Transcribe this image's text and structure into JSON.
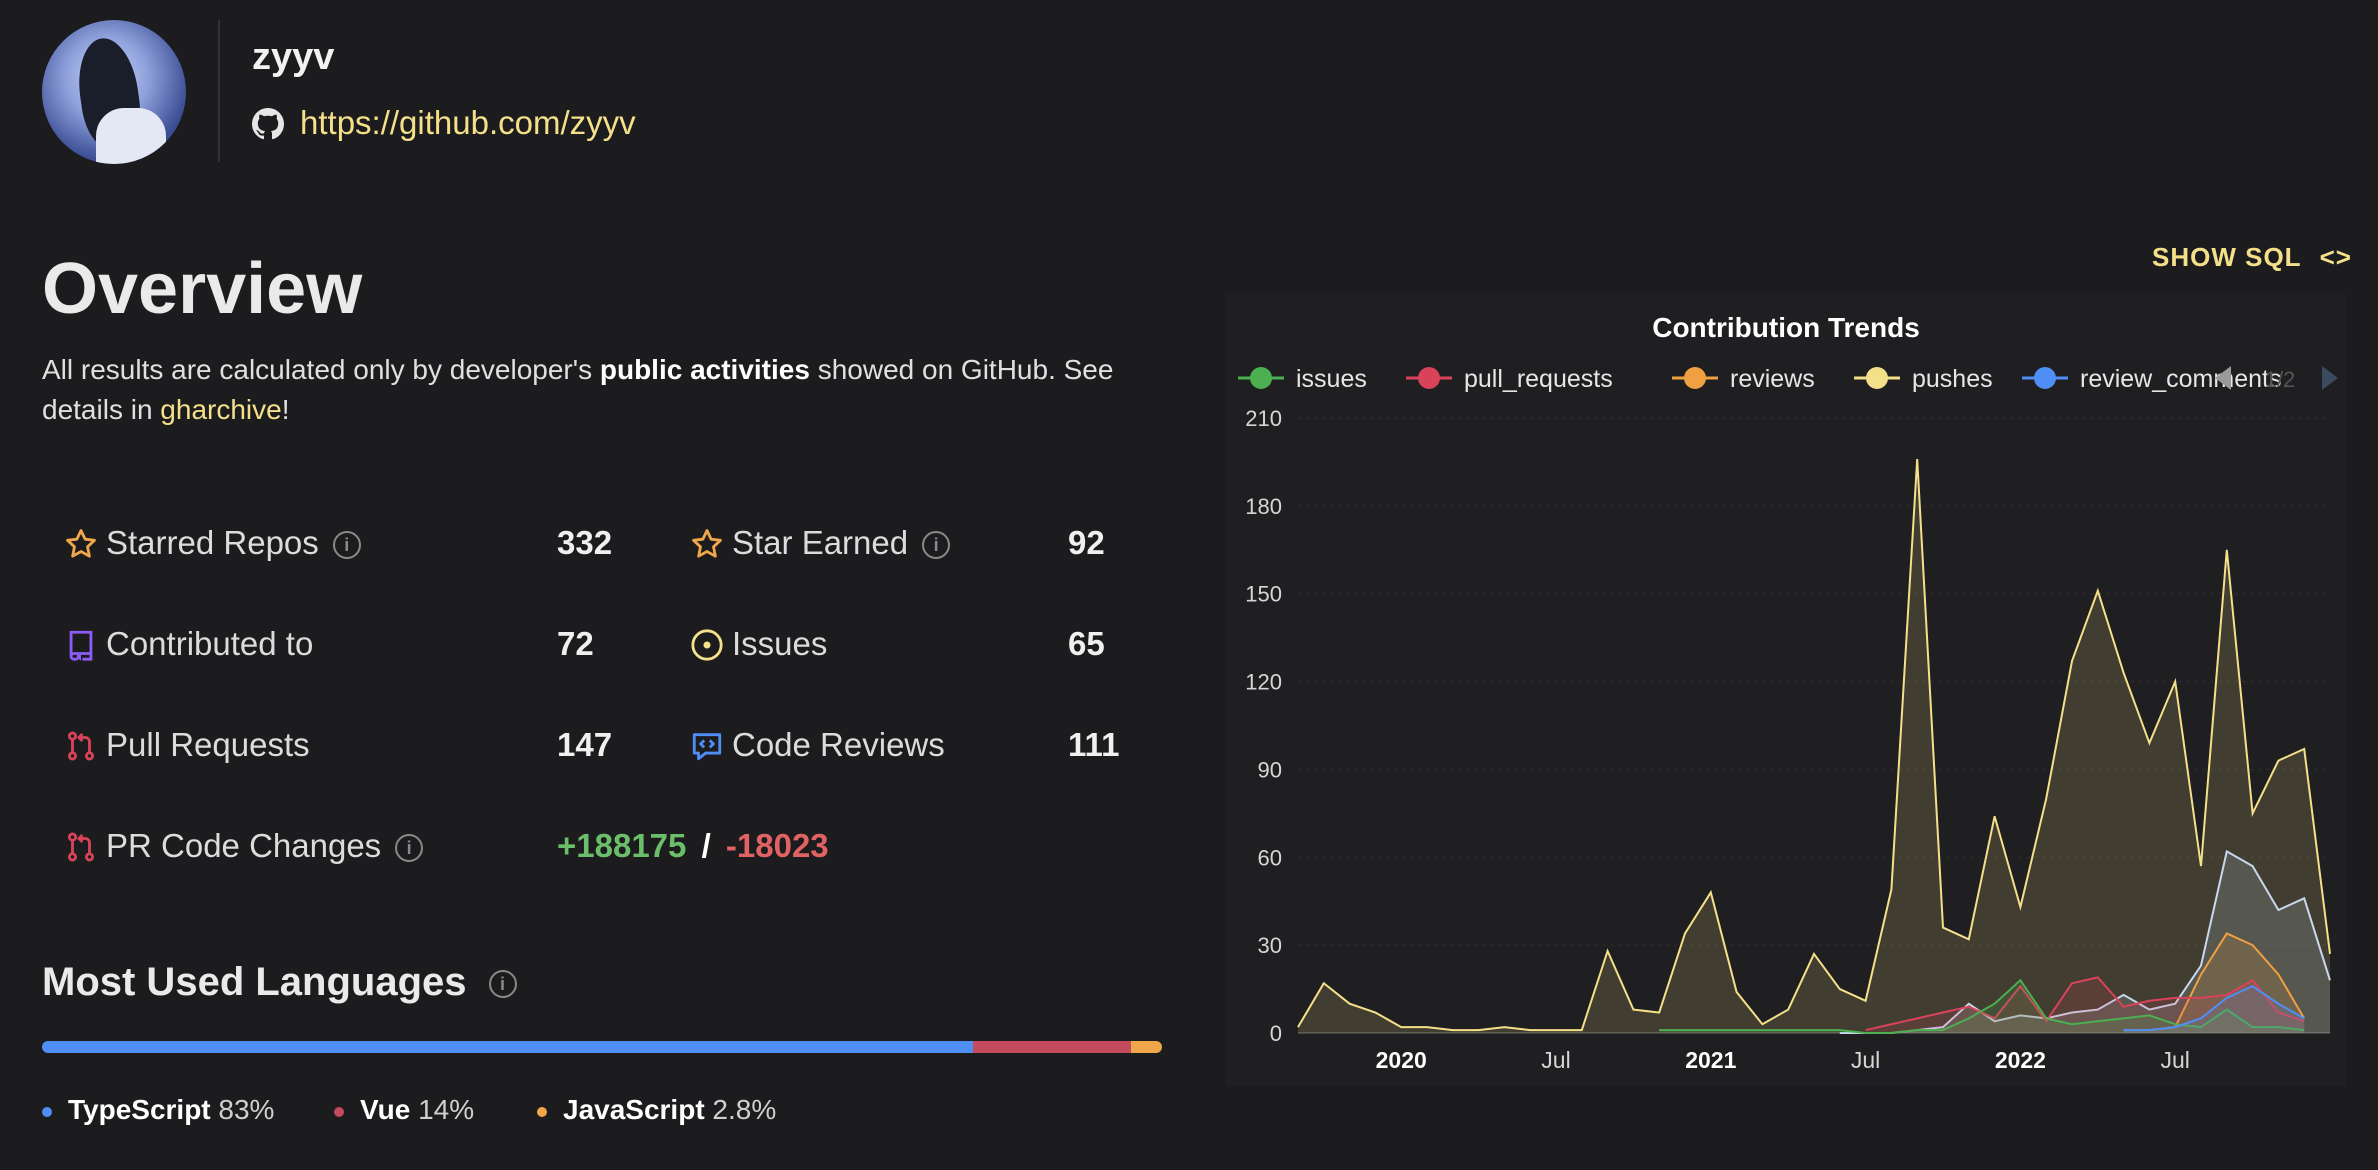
{
  "profile": {
    "username": "zyyv",
    "github_url": "https://github.com/zyyv"
  },
  "overview": {
    "title": "Overview",
    "desc_before": "All results are calculated only by developer's ",
    "desc_bold": "public activities",
    "desc_mid": " showed on GitHub. See details in ",
    "desc_link": "gharchive",
    "desc_after": "!",
    "stats": {
      "starred_repos": {
        "label": "Starred Repos",
        "value": "332"
      },
      "star_earned": {
        "label": "Star Earned",
        "value": "92"
      },
      "contributed_to": {
        "label": "Contributed to",
        "value": "72"
      },
      "issues": {
        "label": "Issues",
        "value": "65"
      },
      "pull_requests": {
        "label": "Pull Requests",
        "value": "147"
      },
      "code_reviews": {
        "label": "Code Reviews",
        "value": "111"
      },
      "pr_code_changes": {
        "label": "PR Code Changes",
        "additions": "+188175",
        "separator": "/",
        "deletions": "-18023"
      }
    }
  },
  "languages": {
    "title": "Most Used Languages",
    "items": [
      {
        "name": "TypeScript",
        "percent": "83%",
        "share": 83,
        "color": "#4f8ef5"
      },
      {
        "name": "Vue",
        "percent": "14%",
        "share": 14,
        "color": "#c44a5e"
      },
      {
        "name": "JavaScript",
        "percent": "2.8%",
        "share": 2.8,
        "color": "#f0a64a"
      }
    ]
  },
  "chart_toolbar": {
    "show_sql_label": "SHOW SQL",
    "code_icon": "code-brackets-icon",
    "legend_page": "1/2"
  },
  "chart_data": {
    "type": "area",
    "title": "Contribution Trends",
    "ylim": [
      0,
      210
    ],
    "y_ticks": [
      "0",
      "30",
      "60",
      "90",
      "120",
      "150",
      "180",
      "210"
    ],
    "x_range": [
      "2019-09",
      "2022-12"
    ],
    "x_ticks": [
      {
        "label": "2020",
        "date": "2020-01",
        "bold": true
      },
      {
        "label": "Jul",
        "date": "2020-07",
        "bold": false
      },
      {
        "label": "2021",
        "date": "2021-01",
        "bold": true
      },
      {
        "label": "Jul",
        "date": "2021-07",
        "bold": false
      },
      {
        "label": "2022",
        "date": "2022-01",
        "bold": true
      },
      {
        "label": "Jul",
        "date": "2022-07",
        "bold": false
      }
    ],
    "grid": true,
    "legend_position": "top",
    "series": [
      {
        "name": "issues",
        "color": "#4caf50",
        "points": [
          [
            "2020-11",
            1
          ],
          [
            "2020-12",
            1
          ],
          [
            "2021-01",
            1
          ],
          [
            "2021-02",
            1
          ],
          [
            "2021-03",
            1
          ],
          [
            "2021-04",
            1
          ],
          [
            "2021-05",
            1
          ],
          [
            "2021-06",
            1
          ],
          [
            "2021-07",
            0
          ],
          [
            "2021-08",
            0
          ],
          [
            "2021-09",
            1
          ],
          [
            "2021-10",
            1
          ],
          [
            "2021-11",
            5
          ],
          [
            "2021-12",
            10
          ],
          [
            "2022-01",
            18
          ],
          [
            "2022-02",
            5
          ],
          [
            "2022-03",
            3
          ],
          [
            "2022-04",
            4
          ],
          [
            "2022-05",
            5
          ],
          [
            "2022-06",
            6
          ],
          [
            "2022-07",
            3
          ],
          [
            "2022-08",
            2
          ],
          [
            "2022-09",
            8
          ],
          [
            "2022-10",
            2
          ],
          [
            "2022-11",
            2
          ],
          [
            "2022-12",
            1
          ]
        ]
      },
      {
        "name": "pull_requests",
        "color": "#d9435a",
        "points": [
          [
            "2021-07",
            1
          ],
          [
            "2021-08",
            3
          ],
          [
            "2021-09",
            5
          ],
          [
            "2021-10",
            7
          ],
          [
            "2021-11",
            9
          ],
          [
            "2021-12",
            5
          ],
          [
            "2022-01",
            16
          ],
          [
            "2022-02",
            4
          ],
          [
            "2022-03",
            17
          ],
          [
            "2022-04",
            19
          ],
          [
            "2022-05",
            9
          ],
          [
            "2022-06",
            11
          ],
          [
            "2022-07",
            12
          ],
          [
            "2022-08",
            12
          ],
          [
            "2022-09",
            13
          ],
          [
            "2022-10",
            18
          ],
          [
            "2022-11",
            7
          ],
          [
            "2022-12",
            4
          ]
        ]
      },
      {
        "name": "reviews",
        "color": "#f0a040",
        "points": [
          [
            "2022-05",
            1
          ],
          [
            "2022-06",
            1
          ],
          [
            "2022-07",
            2
          ],
          [
            "2022-08",
            20
          ],
          [
            "2022-09",
            34
          ],
          [
            "2022-10",
            30
          ],
          [
            "2022-11",
            20
          ],
          [
            "2022-12",
            5
          ]
        ]
      },
      {
        "name": "pushes",
        "color": "#f5e08a",
        "points": [
          [
            "2019-09",
            2
          ],
          [
            "2019-10",
            17
          ],
          [
            "2019-11",
            10
          ],
          [
            "2019-12",
            7
          ],
          [
            "2020-01",
            2
          ],
          [
            "2020-02",
            2
          ],
          [
            "2020-03",
            1
          ],
          [
            "2020-04",
            1
          ],
          [
            "2020-05",
            2
          ],
          [
            "2020-06",
            1
          ],
          [
            "2020-07",
            1
          ],
          [
            "2020-08",
            1
          ],
          [
            "2020-09",
            28
          ],
          [
            "2020-10",
            8
          ],
          [
            "2020-11",
            7
          ],
          [
            "2020-12",
            34
          ],
          [
            "2021-01",
            48
          ],
          [
            "2021-02",
            14
          ],
          [
            "2021-03",
            3
          ],
          [
            "2021-04",
            8
          ],
          [
            "2021-05",
            27
          ],
          [
            "2021-06",
            15
          ],
          [
            "2021-07",
            11
          ],
          [
            "2021-08",
            49
          ],
          [
            "2021-09",
            196
          ],
          [
            "2021-10",
            36
          ],
          [
            "2021-11",
            32
          ],
          [
            "2021-12",
            74
          ],
          [
            "2022-01",
            43
          ],
          [
            "2022-02",
            80
          ],
          [
            "2022-03",
            127
          ],
          [
            "2022-04",
            151
          ],
          [
            "2022-05",
            123
          ],
          [
            "2022-06",
            99
          ],
          [
            "2022-07",
            120
          ],
          [
            "2022-08",
            57
          ],
          [
            "2022-09",
            165
          ],
          [
            "2022-10",
            75
          ],
          [
            "2022-11",
            93
          ],
          [
            "2022-12",
            97
          ],
          [
            "2023-01",
            27
          ]
        ]
      },
      {
        "name": "review_comments",
        "color": "#4f8ef5",
        "points": [
          [
            "2022-05",
            1
          ],
          [
            "2022-06",
            1
          ],
          [
            "2022-07",
            2
          ],
          [
            "2022-08",
            5
          ],
          [
            "2022-09",
            12
          ],
          [
            "2022-10",
            16
          ],
          [
            "2022-11",
            10
          ],
          [
            "2022-12",
            5
          ]
        ]
      },
      {
        "name": "",
        "color": "#c9d8ee",
        "points": [
          [
            "2021-06",
            0
          ],
          [
            "2021-07",
            0
          ],
          [
            "2021-08",
            0
          ],
          [
            "2021-09",
            1
          ],
          [
            "2021-10",
            2
          ],
          [
            "2021-11",
            10
          ],
          [
            "2021-12",
            4
          ],
          [
            "2022-01",
            6
          ],
          [
            "2022-02",
            5
          ],
          [
            "2022-03",
            7
          ],
          [
            "2022-04",
            8
          ],
          [
            "2022-05",
            13
          ],
          [
            "2022-06",
            8
          ],
          [
            "2022-07",
            10
          ],
          [
            "2022-08",
            23
          ],
          [
            "2022-09",
            62
          ],
          [
            "2022-10",
            57
          ],
          [
            "2022-11",
            42
          ],
          [
            "2022-12",
            46
          ],
          [
            "2023-01",
            18
          ]
        ]
      }
    ]
  }
}
